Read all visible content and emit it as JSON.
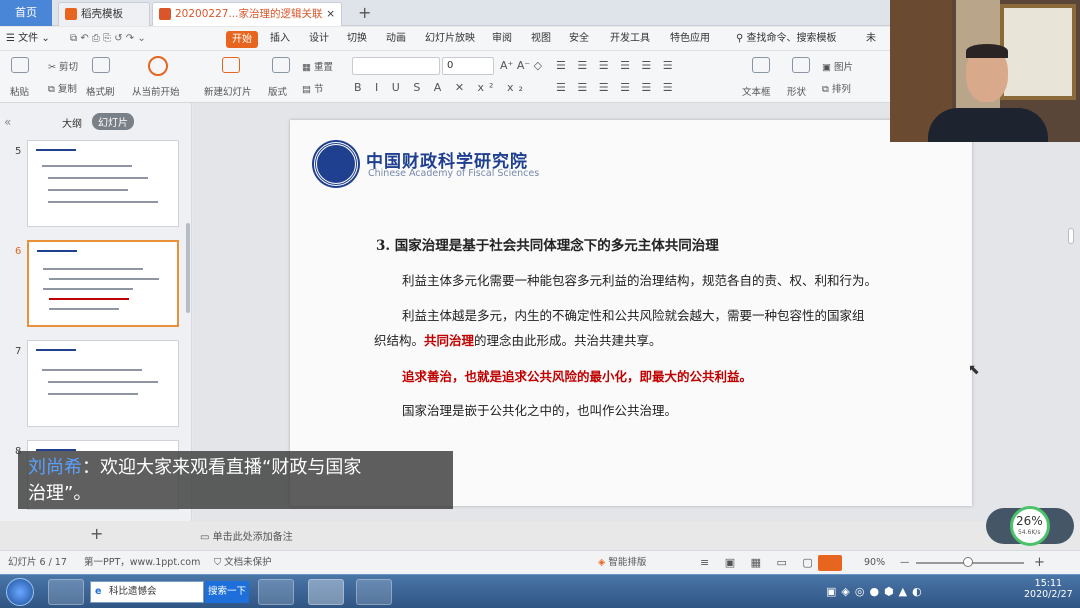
{
  "tabs": {
    "home": "首页",
    "template": "稻壳模板",
    "document": "20200227...家治理的逻辑关联"
  },
  "menu": {
    "file": "文件",
    "start": "开始",
    "insert": "插入",
    "design": "设计",
    "transition": "切换",
    "animation": "动画",
    "slideshow": "幻灯片放映",
    "review": "审阅",
    "view": "视图",
    "security": "安全",
    "developer": "开发工具",
    "features": "特色应用",
    "search_placeholder": "查找命令、搜索模板",
    "more": "未"
  },
  "ribbon": {
    "paste": "粘贴",
    "cut": "剪切",
    "copy": "复制",
    "format_painter": "格式刷",
    "from_current": "从当前开始",
    "new_slide": "新建幻灯片",
    "layout": "版式",
    "section": "节",
    "reset": "重置",
    "font_name": "",
    "font_size": "0",
    "textbox": "文本框",
    "shape": "形状",
    "arrange": "排列",
    "picture": "图片"
  },
  "panel": {
    "outline_tab": "大纲",
    "slides_tab": "幻灯片",
    "slides": [
      {
        "num": "5"
      },
      {
        "num": "6"
      },
      {
        "num": "7"
      },
      {
        "num": "8"
      }
    ]
  },
  "slide": {
    "logo_cn": "中国财政科学研究院",
    "logo_en": "Chinese Academy of Fiscal Sciences",
    "heading": "3.  国家治理是基于社会共同体理念下的多元主体共同治理",
    "p1": "利益主体多元化需要一种能包容多元利益的治理结构，规范各自的责、权、利和行为。",
    "p2a": "利益主体越是多元，内生的不确定性和公共风险就会越大，需要一种包容性的国家组",
    "p2b_pre": "织结构。",
    "p2b_red": "共同治理",
    "p2b_post": "的理念由此形成。共治共建共享。",
    "p3": "追求善治，也就是追求公共风险的最小化，即最大的公共利益。",
    "p4": "国家治理是嵌于公共化之中的，也叫作公共治理。"
  },
  "subtitle": {
    "speaker": "刘尚希",
    "line1": "：欢迎大家来观看直播“财政与国家",
    "line2": "治理”。"
  },
  "notes_placeholder": "单击此处添加备注",
  "status": {
    "slide_count": "幻灯片 6 / 17",
    "theme": "第一PPT，www.1ppt.com",
    "protect": "文档未保护",
    "smart": "智能排版",
    "zoom": "90%"
  },
  "speed": {
    "percent": "26%",
    "rate": "54.6K/s"
  },
  "taskbar": {
    "item1": "科比遗憾会",
    "item2": "搜索一下",
    "time": "15:11",
    "date": "2020/2/27"
  },
  "colors": {
    "accent": "#e8651f",
    "logo_blue": "#1f3f8f",
    "red": "#c00000"
  }
}
